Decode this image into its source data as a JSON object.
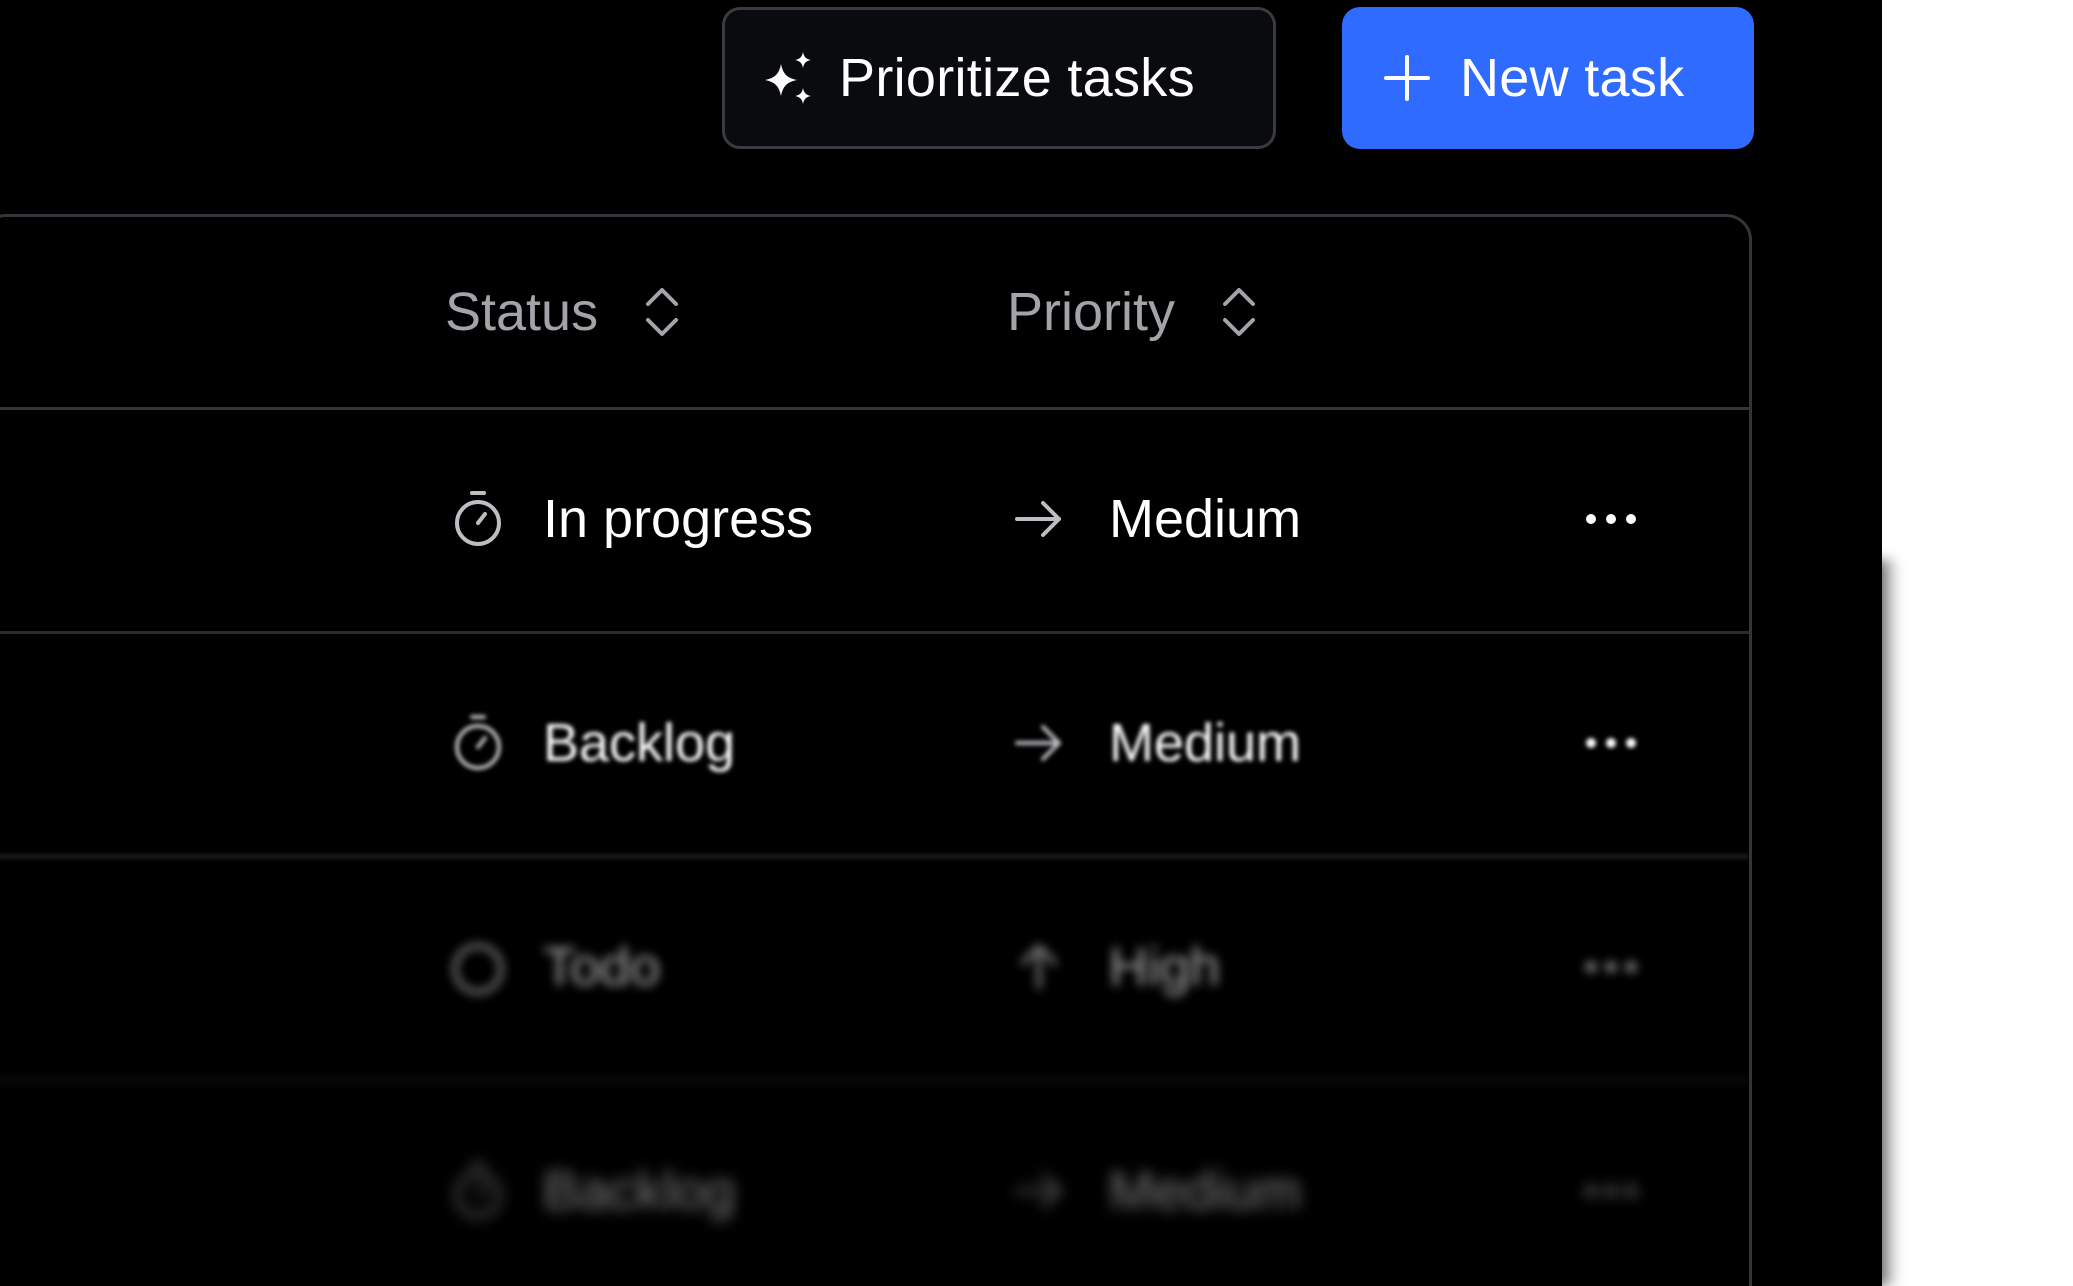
{
  "toolbar": {
    "prioritize_label": "Prioritize tasks",
    "prioritize_icon": "sparkles-icon",
    "new_task_label": "New task",
    "new_task_icon": "plus-icon",
    "accent_color": "#2f6bff"
  },
  "table": {
    "columns": [
      {
        "label": "Status",
        "icon": "sort-icon"
      },
      {
        "label": "Priority",
        "icon": "sort-icon"
      }
    ],
    "rows": [
      {
        "status": "In progress",
        "status_icon": "timer-icon",
        "priority": "Medium",
        "priority_icon": "arrow-right-icon",
        "actions_icon": "more-horizontal-icon"
      },
      {
        "status": "Backlog",
        "status_icon": "timer-icon",
        "priority": "Medium",
        "priority_icon": "arrow-right-icon",
        "actions_icon": "more-horizontal-icon"
      },
      {
        "status": "Todo",
        "status_icon": "circle-icon",
        "priority": "High",
        "priority_icon": "arrow-up-icon",
        "actions_icon": "more-horizontal-icon"
      },
      {
        "status": "Backlog",
        "status_icon": "timer-icon",
        "priority": "Medium",
        "priority_icon": "arrow-right-icon",
        "actions_icon": "more-horizontal-icon"
      }
    ]
  }
}
